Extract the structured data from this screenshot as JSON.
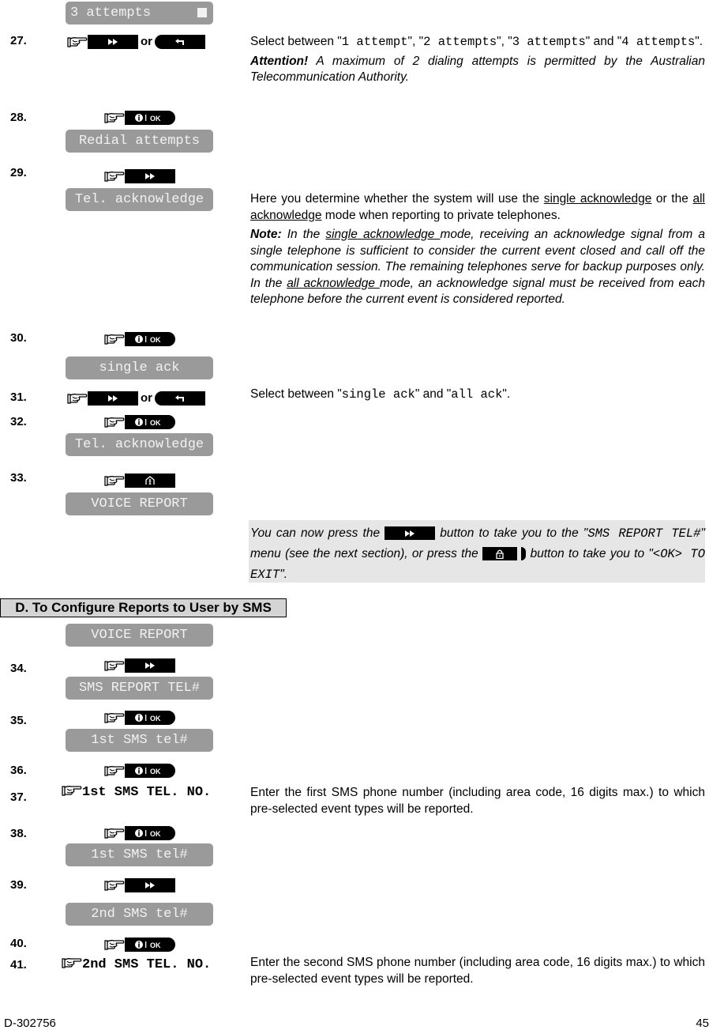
{
  "page": {
    "doc_id": "D-302756",
    "page_number": "45"
  },
  "icons": {
    "hand": "pointing-hand-icon",
    "next": "fast-forward-icon",
    "back": "return-arrow-icon",
    "ok": "info-ok-icon",
    "home": "home-person-icon",
    "lock": "lock-icon"
  },
  "top_display": "3 attempts",
  "or_label": "or",
  "steps": [
    {
      "num": "27.",
      "keys": [
        "next",
        "back"
      ],
      "desc_html": "Select between \"<span class='mono'>1 attempt</span>\", \"<span class='mono'>2 attempts</span>\", \"<span class='mono'>3 attempts</span>\" and \"<span class='mono'>4 attempts</span>\"."
    },
    {
      "num": "28.",
      "keys": [
        "ok"
      ],
      "display": "Redial attempts"
    },
    {
      "num": "29.",
      "keys": [
        "next"
      ],
      "display": "Tel. acknowledge"
    },
    {
      "num": "30.",
      "keys": [
        "ok"
      ],
      "display": "single ack"
    },
    {
      "num": "31.",
      "keys": [
        "next",
        "back"
      ]
    },
    {
      "num": "32.",
      "keys": [
        "ok"
      ],
      "display": "Tel. acknowledge"
    },
    {
      "num": "33.",
      "keys": [
        "home"
      ],
      "display": "VOICE REPORT"
    },
    {
      "num": "34.",
      "keys": [
        "next"
      ],
      "display": "SMS REPORT TEL#"
    },
    {
      "num": "35.",
      "keys": [
        "ok"
      ],
      "display": "1st SMS tel#"
    },
    {
      "num": "36.",
      "keys": [
        "ok"
      ]
    },
    {
      "num": "37.",
      "entry": "1st SMS TEL. NO."
    },
    {
      "num": "38.",
      "keys": [
        "ok"
      ],
      "display": "1st SMS tel#"
    },
    {
      "num": "39.",
      "keys": [
        "next"
      ],
      "display": "2nd SMS tel#"
    },
    {
      "num": "40.",
      "keys": [
        "ok"
      ]
    },
    {
      "num": "41.",
      "entry": "2nd SMS TEL. NO."
    }
  ],
  "descriptions": {
    "s27_attention_label": "Attention!",
    "s27_attention_text": " A maximum of 2 dialing attempts is permitted by the Australian Telecommunication Authority.",
    "s29_main_pre": "Here you determine whether the system will use the ",
    "s29_link1": "single acknowledge",
    "s29_main_mid": " or the ",
    "s29_link2": "all acknowledge",
    "s29_main_post": " mode when reporting to private telephones.",
    "s29_note_label": "Note:",
    "s29_note_1": " In the ",
    "s29_note_link1": "single acknowledge ",
    "s29_note_2": "mode, receiving an acknowledge signal from a single telephone is sufficient to consider the current event closed and call off the communication session. The remaining telephones serve for backup purposes only. In the ",
    "s29_note_link2": "all acknowledge ",
    "s29_note_3": "mode, an acknowledge signal must be received from each telephone before the current event is considered reported.",
    "s31_pre": "Select between \"",
    "s31_opt1": "single ack",
    "s31_mid": "\" and \"",
    "s31_opt2": "all ack",
    "s31_post": "\".",
    "s37": "Enter the first SMS phone number (including area code, 16 digits max.) to which pre-selected event types will be reported.",
    "s41": "Enter the second SMS phone number (including area code, 16 digits max.) to which pre-selected event types will be reported."
  },
  "note_box": {
    "t1": "You can now press the ",
    "t2": " button to take you to th",
    "t3": "e \"",
    "m1": "SMS REPORT TEL#",
    "t4": "\" menu (see the next section), or press the ",
    "t5": " button to take you to \"",
    "m2": "<OK> TO EXIT",
    "t6": "\"."
  },
  "section_title": "D. To Configure Reports to User by SMS",
  "section_display": "VOICE REPORT"
}
